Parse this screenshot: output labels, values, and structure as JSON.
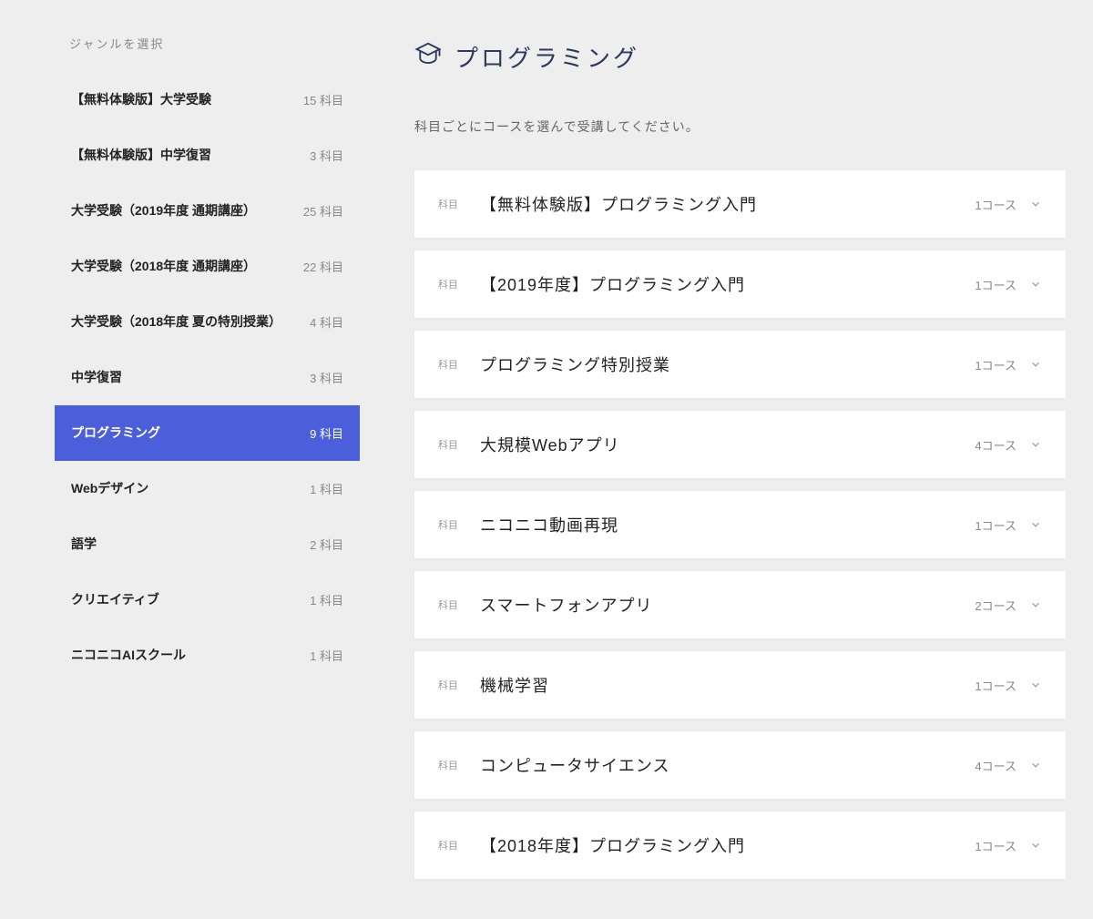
{
  "sidebar": {
    "header": "ジャンルを選択",
    "count_suffix": " 科目",
    "items": [
      {
        "label": "【無料体験版】大学受験",
        "count": 15,
        "active": false
      },
      {
        "label": "【無料体験版】中学復習",
        "count": 3,
        "active": false
      },
      {
        "label": "大学受験（2019年度 通期講座）",
        "count": 25,
        "active": false
      },
      {
        "label": "大学受験（2018年度 通期講座）",
        "count": 22,
        "active": false
      },
      {
        "label": "大学受験（2018年度 夏の特別授業）",
        "count": 4,
        "active": false
      },
      {
        "label": "中学復習",
        "count": 3,
        "active": false
      },
      {
        "label": "プログラミング",
        "count": 9,
        "active": true
      },
      {
        "label": "Webデザイン",
        "count": 1,
        "active": false
      },
      {
        "label": "語学",
        "count": 2,
        "active": false
      },
      {
        "label": "クリエイティブ",
        "count": 1,
        "active": false
      },
      {
        "label": "ニコニコAIスクール",
        "count": 1,
        "active": false
      }
    ]
  },
  "main": {
    "title": "プログラミング",
    "subtitle": "科目ごとにコースを選んで受講してください。",
    "subject_label": "科目",
    "course_suffix": "コース",
    "subjects": [
      {
        "title": "【無料体験版】プログラミング入門",
        "courses": 1
      },
      {
        "title": "【2019年度】プログラミング入門",
        "courses": 1
      },
      {
        "title": "プログラミング特別授業",
        "courses": 1
      },
      {
        "title": "大規模Webアプリ",
        "courses": 4
      },
      {
        "title": "ニコニコ動画再現",
        "courses": 1
      },
      {
        "title": "スマートフォンアプリ",
        "courses": 2
      },
      {
        "title": "機械学習",
        "courses": 1
      },
      {
        "title": "コンピュータサイエンス",
        "courses": 4
      },
      {
        "title": "【2018年度】プログラミング入門",
        "courses": 1
      }
    ]
  }
}
